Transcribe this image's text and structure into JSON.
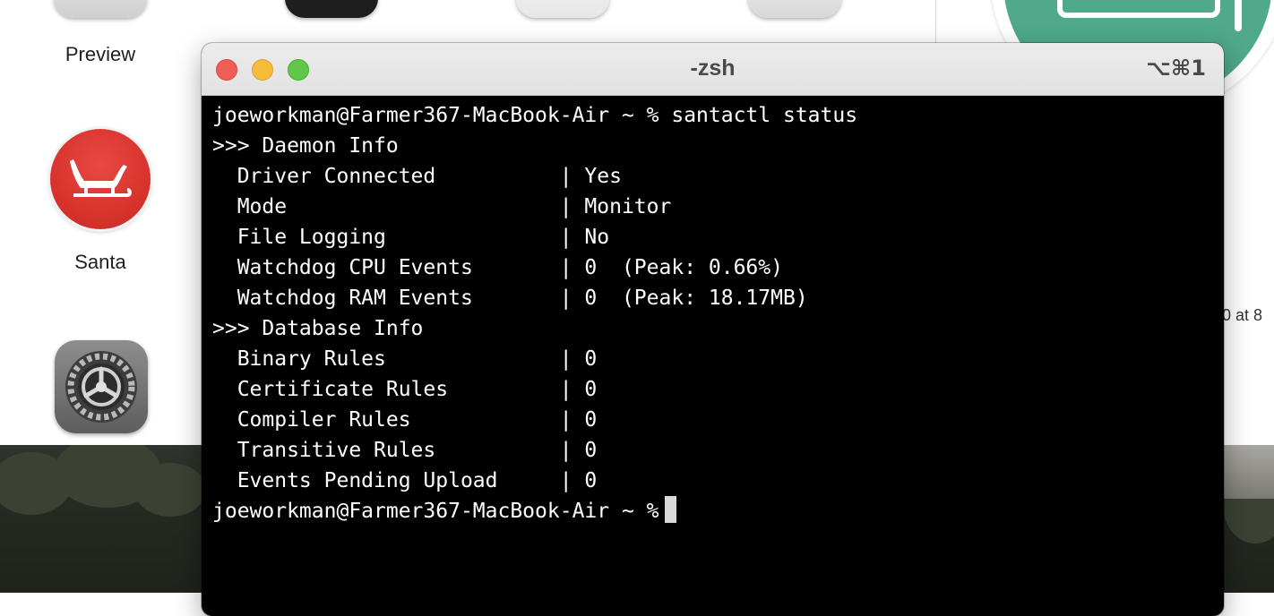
{
  "desktop": {
    "icons": [
      {
        "label": "Preview",
        "icon": "preview-app-icon"
      },
      {
        "label": "Santa",
        "icon": "santa-sleigh-icon"
      },
      {
        "label": "",
        "icon": "system-preferences-gear-icon"
      }
    ],
    "side_text": "0 at 8"
  },
  "terminal": {
    "title": "-zsh",
    "shortcut": "⌥⌘1",
    "colors": {
      "background": "#000000",
      "text": "#ffffff",
      "close": "#ee5e57",
      "minimize": "#f6bd3b",
      "zoom": "#5fc84a"
    },
    "lines": [
      "joeworkman@Farmer367-MacBook-Air ~ % santactl status",
      ">>> Daemon Info",
      "  Driver Connected          | Yes",
      "  Mode                      | Monitor",
      "  File Logging              | No",
      "  Watchdog CPU Events       | 0  (Peak: 0.66%)",
      "  Watchdog RAM Events       | 0  (Peak: 18.17MB)",
      ">>> Database Info",
      "  Binary Rules              | 0",
      "  Certificate Rules         | 0",
      "  Compiler Rules            | 0",
      "  Transitive Rules          | 0",
      "  Events Pending Upload     | 0"
    ],
    "prompt": "joeworkman@Farmer367-MacBook-Air ~ %"
  }
}
